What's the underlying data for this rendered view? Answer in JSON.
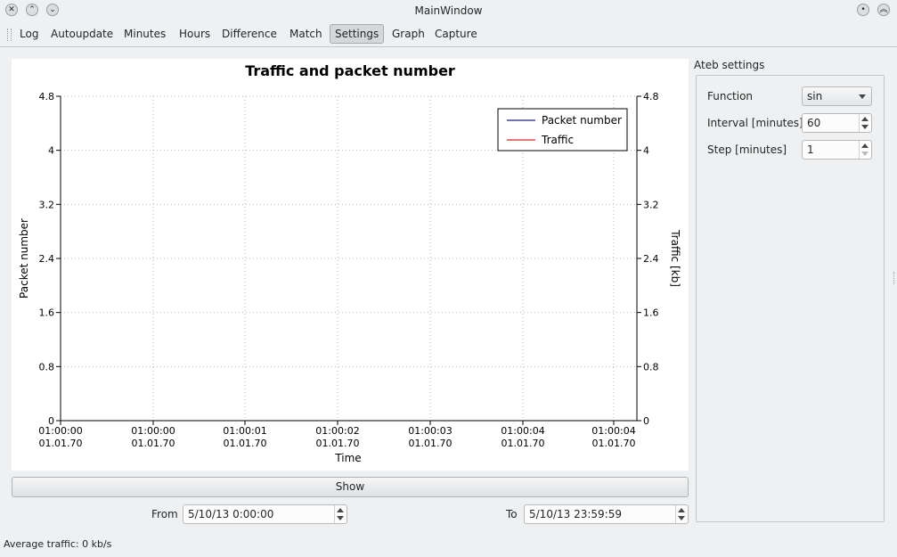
{
  "window": {
    "title": "MainWindow",
    "controls_left": [
      "close-icon",
      "chevron-up-icon",
      "chevron-down-icon"
    ],
    "controls_right": [
      "pin-icon",
      "double-chevron-up-icon"
    ]
  },
  "menu": {
    "items": [
      {
        "label": "Log"
      },
      {
        "label": "Autoupdate"
      },
      {
        "label": "Minutes"
      },
      {
        "label": "Hours"
      },
      {
        "label": "Difference"
      },
      {
        "label": "Match"
      },
      {
        "label": "Settings",
        "active": true
      },
      {
        "label": "Graph"
      },
      {
        "label": "Capture"
      }
    ]
  },
  "chart_data": {
    "type": "line",
    "title": "Traffic and packet number",
    "xlabel": "Time",
    "ylabel": "Packet number",
    "y2label": "Traffic [kb]",
    "x_ticks": [
      [
        "01:00:00",
        "01.01.70"
      ],
      [
        "01:00:00",
        "01.01.70"
      ],
      [
        "01:00:01",
        "01.01.70"
      ],
      [
        "01:00:02",
        "01.01.70"
      ],
      [
        "01:00:03",
        "01.01.70"
      ],
      [
        "01:00:04",
        "01.01.70"
      ],
      [
        "01:00:04",
        "01.01.70"
      ]
    ],
    "y_ticks": [
      "0",
      "0.8",
      "1.6",
      "2.4",
      "3.2",
      "4",
      "4.8"
    ],
    "y2_ticks": [
      "0",
      "0.8",
      "1.6",
      "2.4",
      "3.2",
      "4",
      "4.8"
    ],
    "ylim": [
      0,
      4.8
    ],
    "grid": true,
    "legend_position": "top-right",
    "series": [
      {
        "name": "Packet number",
        "color": "#1c1c9e",
        "values": []
      },
      {
        "name": "Traffic",
        "color": "#e0221f",
        "values": []
      }
    ]
  },
  "settings": {
    "title": "Ateb settings",
    "function_label": "Function",
    "function_value": "sin",
    "interval_label": "Interval [minutes]",
    "interval_value": "60",
    "step_label": "Step [minutes]",
    "step_value": "1"
  },
  "controls": {
    "show_label": "Show",
    "from_label": "From",
    "from_value": "5/10/13 0:00:00",
    "to_label": "To",
    "to_value": "5/10/13 23:59:59"
  },
  "status": {
    "text": "Average traffic: 0 kb/s"
  }
}
